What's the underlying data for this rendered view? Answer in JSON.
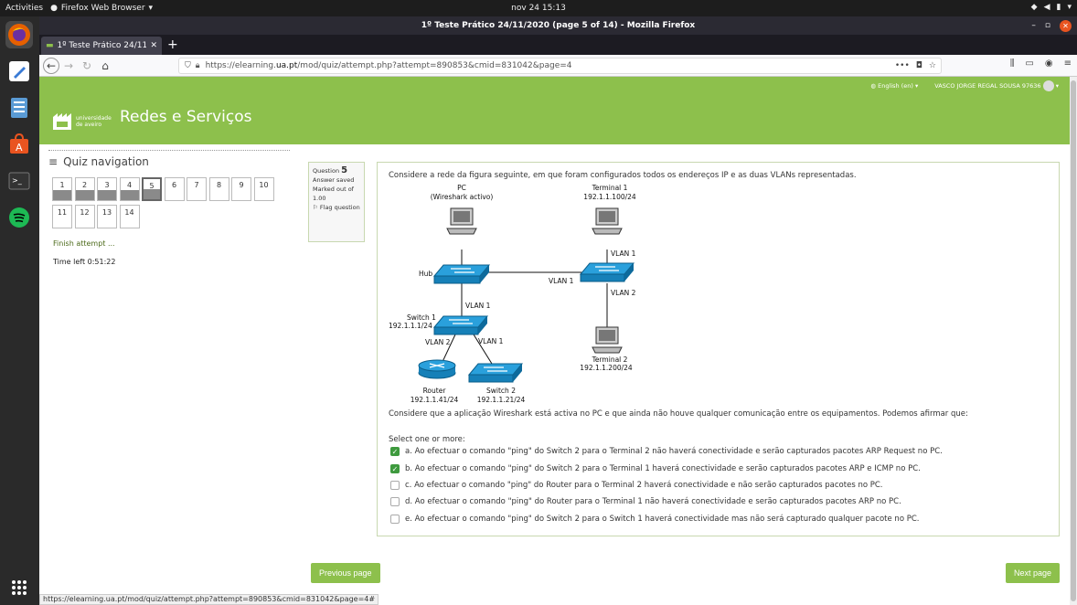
{
  "topbar": {
    "activities": "Activities",
    "app_name": "Firefox Web Browser",
    "clock": "nov 24  15:13"
  },
  "window": {
    "title": "1º Teste Prático 24/11/2020 (page 5 of 14) - Mozilla Firefox"
  },
  "tab": {
    "title": "1º Teste Prático 24/11/2("
  },
  "url": {
    "prefix": "https://elearning.",
    "domain": "ua.pt",
    "suffix": "/mod/quiz/attempt.php?attempt=890853&cmid=831042&page=4"
  },
  "header": {
    "language": "English (en)",
    "user": "VASCO JORGE REGAL SOUSA 97636",
    "logo_text_1": "universidade",
    "logo_text_2": "de aveiro",
    "site_title": "Redes e Serviços"
  },
  "quiz_nav": {
    "title": "Quiz navigation",
    "buttons": [
      {
        "label": "1",
        "answered": true
      },
      {
        "label": "2",
        "answered": true
      },
      {
        "label": "3",
        "answered": true
      },
      {
        "label": "4",
        "answered": true
      },
      {
        "label": "5",
        "answered": true,
        "current": true
      },
      {
        "label": "6",
        "answered": false
      },
      {
        "label": "7",
        "answered": false
      },
      {
        "label": "8",
        "answered": false
      },
      {
        "label": "9",
        "answered": false
      },
      {
        "label": "10",
        "answered": false
      },
      {
        "label": "11",
        "answered": false
      },
      {
        "label": "12",
        "answered": false
      },
      {
        "label": "13",
        "answered": false
      },
      {
        "label": "14",
        "answered": false
      }
    ],
    "finish": "Finish attempt ...",
    "time_left_label": "Time left",
    "time_left_value": "0:51:22"
  },
  "question_info": {
    "label": "Question",
    "number": "5",
    "status": "Answer saved",
    "marked_out_of": "Marked out of 1.00",
    "flag": "Flag question"
  },
  "question": {
    "intro": "Considere a rede da figura seguinte, em que foram configurados todos os endereços IP e as duas VLANs representadas.",
    "text": "Considere que a aplicação Wireshark está activa no PC e que ainda não houve qualquer comunicação entre os equipamentos. Podemos afirmar que:",
    "prompt": "Select one or more:",
    "diagram": {
      "pc_label": "PC",
      "pc_sub": "(Wireshark activo)",
      "terminal1_label": "Terminal 1",
      "terminal1_ip": "192.1.1.100/24",
      "terminal2_label": "Terminal 2",
      "terminal2_ip": "192.1.1.200/24",
      "hub_label": "Hub",
      "switch1_label": "Switch 1",
      "switch1_ip": "192.1.1.1/24",
      "switch2_label": "Switch 2",
      "switch2_ip": "192.1.1.21/24",
      "router_label": "Router",
      "router_ip": "192.1.1.41/24",
      "vlan1": "VLAN 1",
      "vlan2": "VLAN 2"
    },
    "answers": [
      {
        "text": "a. Ao efectuar o comando \"ping\" do Switch 2 para o Terminal 2 não haverá conectividade e serão capturados pacotes ARP Request no PC.",
        "checked": true
      },
      {
        "text": "b. Ao efectuar o comando \"ping\" do Switch 2 para o Terminal 1 haverá conectividade e serão capturados pacotes ARP e ICMP no PC.",
        "checked": true
      },
      {
        "text": "c. Ao efectuar o comando \"ping\" do Router para o Terminal 2 haverá conectividade e não serão capturados pacotes no PC.",
        "checked": false
      },
      {
        "text": "d. Ao efectuar o comando \"ping\" do Router para o Terminal 1 não haverá conectividade e serão capturados pacotes ARP no PC.",
        "checked": false
      },
      {
        "text": "e. Ao efectuar o comando \"ping\" do Switch 2 para o Switch 1 haverá conectividade mas não será capturado qualquer pacote no PC.",
        "checked": false
      }
    ]
  },
  "buttons": {
    "previous": "Previous page",
    "next": "Next page"
  },
  "status_bar": "https://elearning.ua.pt/mod/quiz/attempt.php?attempt=890853&cmid=831042&page=4#",
  "colors": {
    "accent": "#8dc04c",
    "checkbox": "#3e9a3e",
    "ubuntu_orange": "#e95420"
  }
}
